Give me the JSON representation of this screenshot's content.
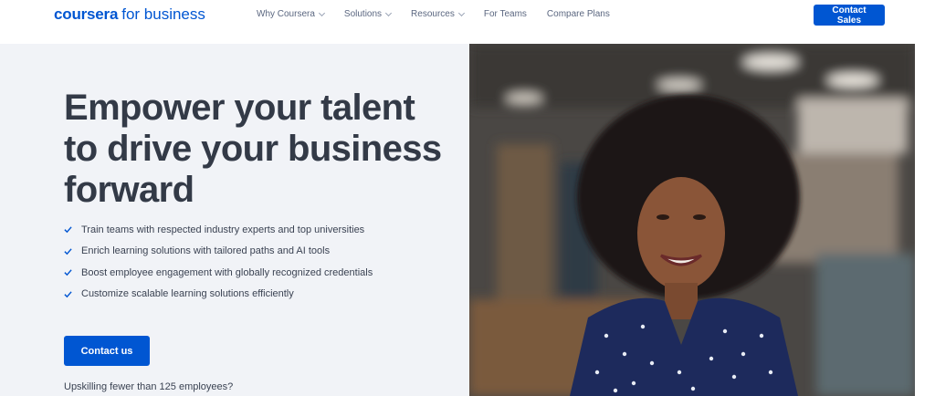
{
  "nav": {
    "logo_brand": "coursera",
    "logo_sub": "for business",
    "items": [
      {
        "label": "Why Coursera",
        "dropdown": true
      },
      {
        "label": "Solutions",
        "dropdown": true
      },
      {
        "label": "Resources",
        "dropdown": true
      },
      {
        "label": "For Teams",
        "dropdown": false
      },
      {
        "label": "Compare Plans",
        "dropdown": false
      }
    ],
    "cta_label": "Contact Sales"
  },
  "hero": {
    "headline": "Empower your talent to drive your business forward",
    "bullets": [
      "Train teams with respected industry experts and top universities",
      "Enrich learning solutions with tailored paths and AI tools",
      "Boost employee engagement with globally recognized credentials",
      "Customize scalable learning solutions efficiently"
    ],
    "cta_label": "Contact us",
    "small_question": "Upskilling fewer than 125 employees?"
  },
  "colors": {
    "brand": "#0056d2",
    "check": "#0056d2",
    "headline": "#333a47",
    "hero_bg": "#f1f3f7"
  },
  "icons": {
    "bullet": "check-icon",
    "dropdown": "chevron-down-icon"
  }
}
